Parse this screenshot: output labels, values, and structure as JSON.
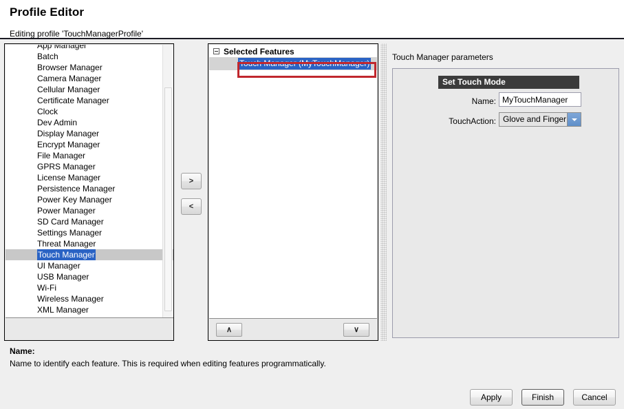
{
  "header": {
    "title": "Profile Editor",
    "subtitle": "Editing profile 'TouchManagerProfile'"
  },
  "features_list": {
    "clipped_top_item": "App Manager",
    "items": [
      "Batch",
      "Browser Manager",
      "Camera Manager",
      "Cellular Manager",
      "Certificate Manager",
      "Clock",
      "Dev Admin",
      "Display Manager",
      "Encrypt Manager",
      "File Manager",
      "GPRS Manager",
      "License Manager",
      "Persistence Manager",
      "Power Key Manager",
      "Power Manager",
      "SD Card Manager",
      "Settings Manager",
      "Threat Manager",
      "Touch Manager",
      "UI Manager",
      "USB Manager",
      "Wi-Fi",
      "Wireless Manager",
      "XML Manager"
    ],
    "selected_item": "Touch Manager",
    "selection_color": "#2a63c4",
    "row_highlight_color": "#c8c8c8"
  },
  "transfer_buttons": {
    "add_label": ">",
    "remove_label": "<"
  },
  "selected_features_tree": {
    "root_label": "Selected Features",
    "expander_state": "expanded",
    "child_label": "Touch Manager (MyTouchManager)",
    "child_selected": true,
    "annotation_color": "#c0272d"
  },
  "move_buttons": {
    "up_label": "∧",
    "down_label": "∨"
  },
  "parameters_panel": {
    "title": "Touch Manager parameters",
    "section_header": "Set Touch Mode",
    "section_header_bg": "#3b3b3b",
    "fields": {
      "name_label": "Name:",
      "name_value": "MyTouchManager",
      "touchaction_label": "TouchAction:",
      "touchaction_value": "Glove and Finger"
    }
  },
  "description": {
    "title": "Name:",
    "text": "Name to identify each feature. This is required when editing features programmatically."
  },
  "footer": {
    "apply_label": "Apply",
    "finish_label": "Finish",
    "cancel_label": "Cancel"
  }
}
